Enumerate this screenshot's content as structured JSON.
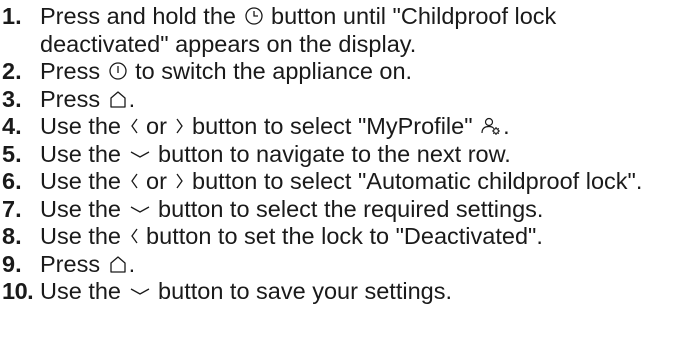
{
  "steps": [
    {
      "number": "1.",
      "parts": [
        "Press and hold the ",
        " button until \"Childproof lock deactivated\" appears on the display."
      ],
      "icons": [
        "clock-icon"
      ]
    },
    {
      "number": "2.",
      "parts": [
        "Press ",
        " to switch the appliance on."
      ],
      "icons": [
        "power-icon"
      ]
    },
    {
      "number": "3.",
      "parts": [
        "Press ",
        "."
      ],
      "icons": [
        "home-icon"
      ]
    },
    {
      "number": "4.",
      "parts": [
        "Use the ",
        " or ",
        " button to select \"MyProfile\" ",
        "."
      ],
      "icons": [
        "chevron-left-icon",
        "chevron-right-icon",
        "profile-icon"
      ]
    },
    {
      "number": "5.",
      "parts": [
        "Use the ",
        " button to navigate to the next row."
      ],
      "icons": [
        "chevron-down-icon"
      ]
    },
    {
      "number": "6.",
      "parts": [
        "Use the ",
        " or ",
        " button to select \"Automatic childproof lock\"."
      ],
      "icons": [
        "chevron-left-icon",
        "chevron-right-icon"
      ]
    },
    {
      "number": "7.",
      "parts": [
        "Use the ",
        " button to select the required settings."
      ],
      "icons": [
        "chevron-down-icon"
      ]
    },
    {
      "number": "8.",
      "parts": [
        "Use the ",
        " button to set the lock to \"Deactivated\"."
      ],
      "icons": [
        "chevron-left-icon"
      ]
    },
    {
      "number": "9.",
      "parts": [
        "Press ",
        "."
      ],
      "icons": [
        "home-icon"
      ]
    },
    {
      "number": "10.",
      "parts": [
        "Use the ",
        " button to save your settings."
      ],
      "icons": [
        "chevron-down-icon"
      ]
    }
  ]
}
